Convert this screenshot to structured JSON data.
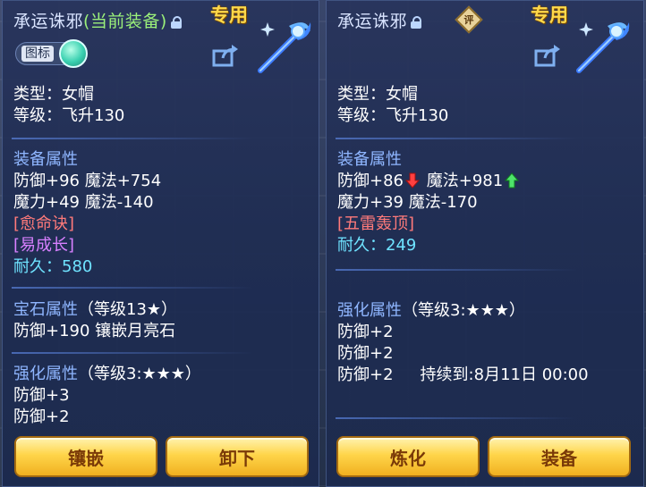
{
  "left": {
    "title": "承运诛邪",
    "current_tag": "(当前装备)",
    "exclusive": "专用",
    "toggle_label": "图标",
    "type_line": "类型：女帽",
    "level_line": "等级：飞升130",
    "equip_attr_header": "装备属性",
    "attr_line1": "防御+96 魔法+754",
    "attr_line2": "魔力+49 魔法-140",
    "special1": "[愈命诀]",
    "special2": "[易成长]",
    "durability_label": "耐久：",
    "durability_value": "580",
    "gem_header": "宝石属性",
    "gem_level": "（等级13★）",
    "gem_line": "防御+190 镶嵌月亮石",
    "enhance_header": "强化属性",
    "enhance_level": "（等级3:★★★）",
    "enhance_line1": "防御+3",
    "enhance_line2": "防御+2",
    "buttons": {
      "inlay": "镶嵌",
      "unequip": "卸下"
    }
  },
  "right": {
    "title": "承运诛邪",
    "badge": "评",
    "exclusive": "专用",
    "type_line": "类型：女帽",
    "level_line": "等级：飞升130",
    "equip_attr_header": "装备属性",
    "attr_def": "防御+86",
    "attr_magic": "魔法+981",
    "attr_line2": "魔力+39 魔法-170",
    "special1": "[五雷轰顶]",
    "durability_label": "耐久：",
    "durability_value": "249",
    "enhance_header": "强化属性",
    "enhance_level": "（等级3:★★★）",
    "enhance_line1": "防御+2",
    "enhance_line2": "防御+2",
    "enhance_line3": "防御+2",
    "duration": "持续到:8月11日 00:00",
    "buttons": {
      "refine": "炼化",
      "equip": "装备"
    }
  },
  "colors": {
    "header": "#8fb6ff",
    "gold": "#ffd94a",
    "cyan": "#6fe3ff",
    "red": "#ff7a7a",
    "purple": "#d880ff"
  }
}
